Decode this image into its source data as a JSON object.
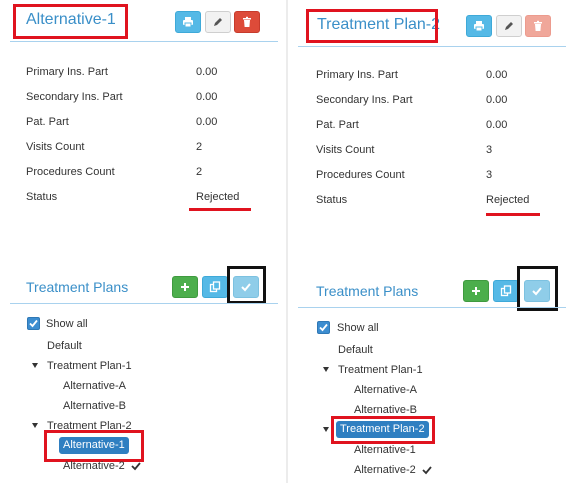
{
  "left": {
    "title": "Alternative-1",
    "rows": [
      {
        "label": "Primary Ins. Part",
        "value": "0.00"
      },
      {
        "label": "Secondary Ins. Part",
        "value": "0.00"
      },
      {
        "label": "Pat. Part",
        "value": "0.00"
      },
      {
        "label": "Visits Count",
        "value": "2"
      },
      {
        "label": "Procedures Count",
        "value": "2"
      },
      {
        "label": "Status",
        "value": "Rejected"
      }
    ],
    "plans_title": "Treatment Plans",
    "show_all": "Show all",
    "tree": {
      "default": "Default",
      "plan1": "Treatment Plan-1",
      "plan1_alt_a": "Alternative-A",
      "plan1_alt_b": "Alternative-B",
      "plan2": "Treatment Plan-2",
      "plan2_alt_1": "Alternative-1",
      "plan2_alt_2": "Alternative-2"
    }
  },
  "right": {
    "title": "Treatment Plan-2",
    "rows": [
      {
        "label": "Primary Ins. Part",
        "value": "0.00"
      },
      {
        "label": "Secondary Ins. Part",
        "value": "0.00"
      },
      {
        "label": "Pat. Part",
        "value": "0.00"
      },
      {
        "label": "Visits Count",
        "value": "3"
      },
      {
        "label": "Procedures Count",
        "value": "3"
      },
      {
        "label": "Status",
        "value": "Rejected"
      }
    ],
    "plans_title": "Treatment Plans",
    "show_all": "Show all",
    "tree": {
      "default": "Default",
      "plan1": "Treatment Plan-1",
      "plan1_alt_a": "Alternative-A",
      "plan1_alt_b": "Alternative-B",
      "plan2": "Treatment Plan-2",
      "plan2_alt_1": "Alternative-1",
      "plan2_alt_2": "Alternative-2"
    }
  },
  "icons": {
    "print": "print-icon",
    "edit": "pencil-icon",
    "delete": "trash-icon",
    "add": "plus-icon",
    "copy": "copy-icon",
    "approve": "check-icon"
  },
  "colors": {
    "title": "#3a8fc8",
    "accent_blue": "#2f7fc1",
    "annotation_red": "#e0131f",
    "add_green": "#4cae4c",
    "delete_red": "#dd4b39"
  }
}
